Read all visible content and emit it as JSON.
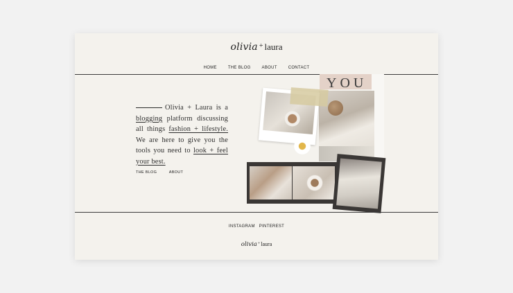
{
  "brand": {
    "script": "olivia",
    "plus": "+",
    "name": "laura"
  },
  "nav": [
    "HOME",
    "THE BLOG",
    "ABOUT",
    "CONTACT"
  ],
  "intro": {
    "p1": "Olivia + Laura is a",
    "link_blogging": "blogging",
    "p2": " platform discussing all things ",
    "link_fashion": "fashion + lifestyle.",
    "p3": " We are here to give you the tools you need to ",
    "link_look": "look + feel your best."
  },
  "sublinks": [
    "THE BLOG",
    "ABOUT"
  ],
  "collage": {
    "you_text": "YOU"
  },
  "footer": {
    "links": [
      "INSTAGRAM",
      "PINTEREST"
    ]
  }
}
